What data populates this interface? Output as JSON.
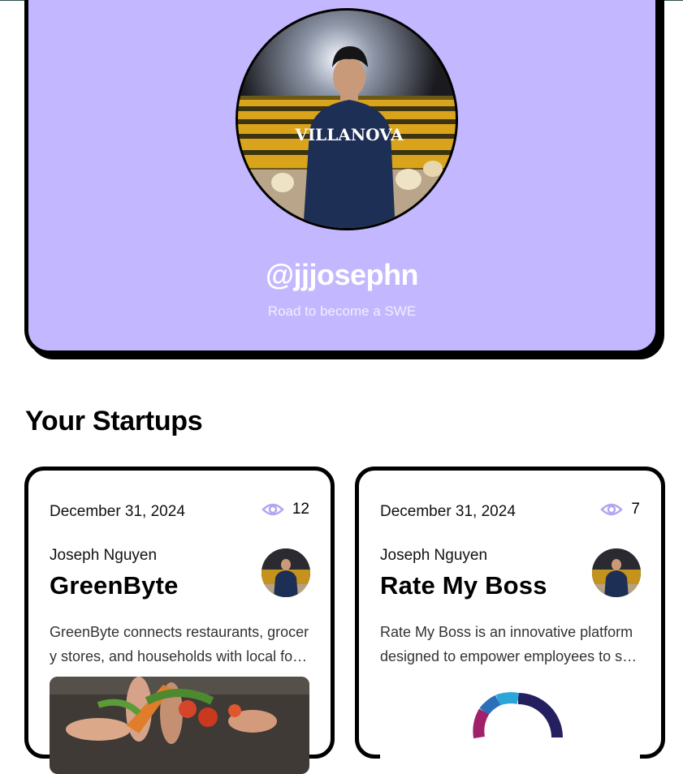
{
  "profile": {
    "username": "@jjjosephn",
    "bio": "Road to become a SWE"
  },
  "section": {
    "title": "Your Startups"
  },
  "startups": [
    {
      "date": "December 31, 2024",
      "views": "12",
      "author": "Joseph Nguyen",
      "title": "GreenByte",
      "description": "GreenByte connects restaurants, grocery stores, and households with local food banks and shelters to reduce food waste."
    },
    {
      "date": "December 31, 2024",
      "views": "7",
      "author": "Joseph Nguyen",
      "title": "Rate My Boss",
      "description": "Rate My Boss is an innovative platform designed to empower employees to share honest reviews about their managers."
    }
  ],
  "colors": {
    "profile_bg": "#c3b8ff",
    "eye_icon": "#b3a6f2",
    "border": "#000000"
  }
}
